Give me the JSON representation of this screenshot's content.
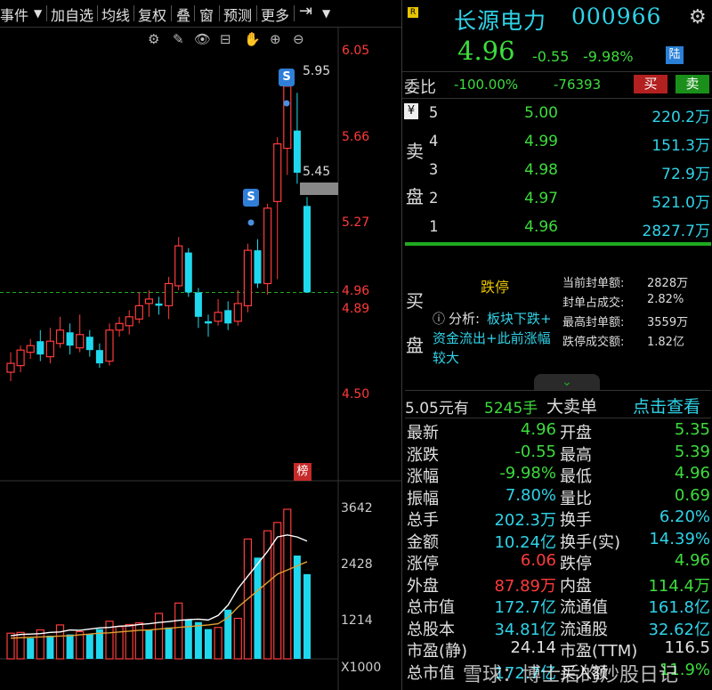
{
  "toolbar": {
    "items": [
      "事件",
      "加自选",
      "均线",
      "复权",
      "叠",
      "窗",
      "预测",
      "更多"
    ],
    "dropdown_icon": "chevron-down-icon",
    "collapse_icon": "panel-collapse-icon",
    "tools": [
      "settings-icon",
      "pen-icon",
      "eye-icon",
      "bag-icon",
      "hand-icon",
      "zoom-in-icon",
      "zoom-out-icon"
    ]
  },
  "chart": {
    "price_axis": [
      "6.05",
      "5.66",
      "5.27",
      "4.96",
      "4.89",
      "4.50"
    ],
    "high_label": "5.95",
    "s_markers": [
      "S",
      "S"
    ],
    "current_label": "5.45",
    "rank_badge": "榜",
    "volume_axis": [
      "3642",
      "2428",
      "1214",
      "X1000"
    ]
  },
  "chart_data": [
    {
      "type": "candlestick",
      "title": "",
      "ylim": [
        4.3,
        6.1
      ],
      "candles": [
        {
          "o": 4.6,
          "c": 4.64,
          "h": 4.69,
          "l": 4.56,
          "up": true
        },
        {
          "o": 4.63,
          "c": 4.7,
          "h": 4.72,
          "l": 4.6,
          "up": true
        },
        {
          "o": 4.69,
          "c": 4.72,
          "h": 4.75,
          "l": 4.66,
          "up": true
        },
        {
          "o": 4.74,
          "c": 4.68,
          "h": 4.79,
          "l": 4.65,
          "up": false
        },
        {
          "o": 4.67,
          "c": 4.74,
          "h": 4.8,
          "l": 4.64,
          "up": true
        },
        {
          "o": 4.73,
          "c": 4.79,
          "h": 4.85,
          "l": 4.71,
          "up": true
        },
        {
          "o": 4.78,
          "c": 4.72,
          "h": 4.82,
          "l": 4.68,
          "up": false
        },
        {
          "o": 4.71,
          "c": 4.77,
          "h": 4.86,
          "l": 4.69,
          "up": true
        },
        {
          "o": 4.76,
          "c": 4.7,
          "h": 4.79,
          "l": 4.67,
          "up": false
        },
        {
          "o": 4.7,
          "c": 4.64,
          "h": 4.73,
          "l": 4.62,
          "up": false
        },
        {
          "o": 4.65,
          "c": 4.79,
          "h": 4.82,
          "l": 4.63,
          "up": true
        },
        {
          "o": 4.79,
          "c": 4.82,
          "h": 4.85,
          "l": 4.76,
          "up": true
        },
        {
          "o": 4.81,
          "c": 4.85,
          "h": 4.88,
          "l": 4.77,
          "up": true
        },
        {
          "o": 4.84,
          "c": 4.9,
          "h": 4.96,
          "l": 4.82,
          "up": true
        },
        {
          "o": 4.91,
          "c": 4.93,
          "h": 4.97,
          "l": 4.85,
          "up": true
        },
        {
          "o": 4.91,
          "c": 4.9,
          "h": 4.94,
          "l": 4.86,
          "up": false
        },
        {
          "o": 4.9,
          "c": 5.0,
          "h": 5.03,
          "l": 4.84,
          "up": true
        },
        {
          "o": 4.99,
          "c": 5.17,
          "h": 5.21,
          "l": 4.97,
          "up": true
        },
        {
          "o": 5.14,
          "c": 4.96,
          "h": 5.16,
          "l": 4.94,
          "up": false
        },
        {
          "o": 4.96,
          "c": 4.85,
          "h": 4.98,
          "l": 4.8,
          "up": false
        },
        {
          "o": 4.83,
          "c": 4.82,
          "h": 4.86,
          "l": 4.76,
          "up": false
        },
        {
          "o": 4.83,
          "c": 4.87,
          "h": 4.93,
          "l": 4.81,
          "up": true
        },
        {
          "o": 4.88,
          "c": 4.82,
          "h": 4.92,
          "l": 4.79,
          "up": false
        },
        {
          "o": 4.83,
          "c": 4.91,
          "h": 4.97,
          "l": 4.81,
          "up": true
        },
        {
          "o": 4.9,
          "c": 5.15,
          "h": 5.18,
          "l": 4.87,
          "up": true
        },
        {
          "o": 5.15,
          "c": 5.0,
          "h": 5.2,
          "l": 4.98,
          "up": false
        },
        {
          "o": 5.0,
          "c": 5.34,
          "h": 5.36,
          "l": 4.95,
          "up": true
        },
        {
          "o": 5.37,
          "c": 5.63,
          "h": 5.66,
          "l": 5.02,
          "up": true
        },
        {
          "o": 5.61,
          "c": 5.89,
          "h": 5.95,
          "l": 5.49,
          "up": true
        },
        {
          "o": 5.69,
          "c": 5.5,
          "h": 5.86,
          "l": 5.45,
          "up": false
        },
        {
          "o": 5.35,
          "c": 4.96,
          "h": 5.39,
          "l": 4.96,
          "up": false
        }
      ]
    },
    {
      "type": "bar",
      "title": "",
      "ylabel": "X1000",
      "ylim": [
        0,
        3900
      ],
      "values": [
        620,
        640,
        500,
        700,
        560,
        820,
        590,
        660,
        600,
        720,
        910,
        780,
        830,
        870,
        700,
        1100,
        760,
        1350,
        940,
        890,
        720,
        760,
        1190,
        980,
        2900,
        2450,
        3100,
        3300,
        3620,
        2500,
        2050
      ],
      "up": [
        true,
        true,
        false,
        true,
        false,
        true,
        false,
        true,
        false,
        false,
        true,
        true,
        true,
        true,
        false,
        true,
        false,
        true,
        false,
        false,
        false,
        true,
        false,
        true,
        true,
        false,
        true,
        true,
        true,
        false,
        false
      ],
      "ma1": [
        560,
        590,
        600,
        610,
        640,
        650,
        700,
        690,
        720,
        750,
        760,
        790,
        800,
        830,
        850,
        880,
        900,
        930,
        950,
        960,
        940,
        1050,
        1300,
        1700,
        2000,
        2300,
        2600,
        2950,
        3000,
        2950,
        2850
      ],
      "ma2": [
        500,
        510,
        520,
        530,
        540,
        550,
        560,
        580,
        600,
        620,
        630,
        650,
        670,
        690,
        700,
        720,
        740,
        760,
        780,
        800,
        820,
        850,
        1000,
        1250,
        1450,
        1650,
        1850,
        2050,
        2150,
        2250,
        2350
      ]
    }
  ],
  "stock": {
    "name": "长源电力",
    "code": "000966",
    "price": "4.96",
    "change": "-0.55",
    "change_pct": "-9.98%",
    "market_badge": "陆"
  },
  "commission": {
    "label": "委比",
    "ratio": "-100.00%",
    "diff": "-76393",
    "buy_label": "买",
    "sell_label": "卖"
  },
  "sell_side": {
    "label_top": "卖",
    "label_bottom": "盘",
    "currency": "¥",
    "rows": [
      {
        "n": "5",
        "price": "5.00",
        "vol": "220.2万"
      },
      {
        "n": "4",
        "price": "4.99",
        "vol": "151.3万"
      },
      {
        "n": "3",
        "price": "4.98",
        "vol": "72.9万"
      },
      {
        "n": "2",
        "price": "4.97",
        "vol": "521.0万"
      },
      {
        "n": "1",
        "price": "4.96",
        "vol": "2827.7万"
      }
    ]
  },
  "buy_side": {
    "label_top": "买",
    "label_bottom": "盘",
    "limit_text": "跌停",
    "analysis_label": "分析:",
    "analysis_text_1": "板块下跌+",
    "analysis_text_2": "资金流出+此前涨幅",
    "analysis_text_3": "较大",
    "seal_rows": [
      {
        "label": "当前封单额:",
        "value": "2828万"
      },
      {
        "label": "封单占成交:",
        "value": "2.82%"
      },
      {
        "label": "最高封单额:",
        "value": "3559万"
      },
      {
        "label": "跌停成交额:",
        "value": "1.82亿"
      }
    ]
  },
  "big_order": {
    "price_text": "5.05元有",
    "qty": "5245手",
    "type": "大卖单",
    "link": "点击查看"
  },
  "stats": [
    {
      "l1": "最新",
      "v1": "4.96",
      "c1": "gv",
      "l2": "开盘",
      "v2": "5.35",
      "c2": "gv"
    },
    {
      "l1": "涨跌",
      "v1": "-0.55",
      "c1": "gv",
      "l2": "最高",
      "v2": "5.39",
      "c2": "gv"
    },
    {
      "l1": "涨幅",
      "v1": "-9.98%",
      "c1": "gv",
      "l2": "最低",
      "v2": "4.96",
      "c2": "gv"
    },
    {
      "l1": "振幅",
      "v1": "7.80%",
      "c1": "cv",
      "l2": "量比",
      "v2": "0.69",
      "c2": "gv"
    },
    {
      "l1": "总手",
      "v1": "202.3万",
      "c1": "cv",
      "l2": "换手",
      "v2": "6.20%",
      "c2": "cv"
    },
    {
      "l1": "金额",
      "v1": "10.24亿",
      "c1": "cv",
      "l2": "换手(实)",
      "v2": "14.39%",
      "c2": "cv"
    },
    {
      "l1": "涨停",
      "v1": "6.06",
      "c1": "rv",
      "l2": "跌停",
      "v2": "4.96",
      "c2": "gv"
    },
    {
      "l1": "外盘",
      "v1": "87.89万",
      "c1": "rv",
      "l2": "内盘",
      "v2": "114.4万",
      "c2": "gv"
    },
    {
      "l1": "总市值",
      "v1": "172.7亿",
      "c1": "cv",
      "l2": "流通值",
      "v2": "161.8亿",
      "c2": "cv"
    },
    {
      "l1": "总股本",
      "v1": "34.81亿",
      "c1": "cv",
      "l2": "流通股",
      "v2": "32.62亿",
      "c2": "cv"
    },
    {
      "l1": "市盈(静)",
      "v1": "24.14",
      "c1": "lbl",
      "l2": "市盈(TTM)",
      "v2": "116.5",
      "c2": "lbl"
    },
    {
      "l1": "总市值",
      "v1": "172.7亿",
      "c1": "cv",
      "l2": "买入额",
      "v2": "11.9%",
      "c2": "gv"
    }
  ],
  "watermark": "雪球：博士后的炒股日记"
}
